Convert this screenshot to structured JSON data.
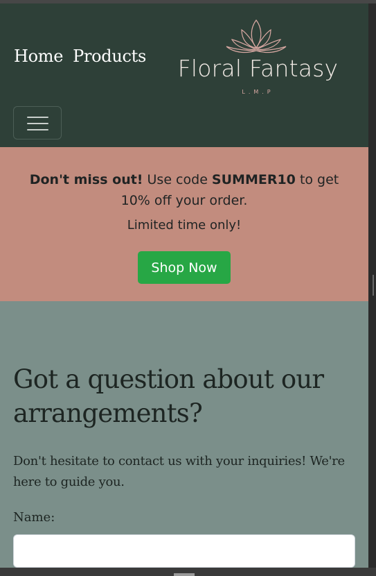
{
  "nav": {
    "home_label": "Home",
    "products_label": "Products",
    "toggle_icon": "hamburger-menu-icon"
  },
  "logo": {
    "name": "Floral Fantasy",
    "subtitle": "L.M.P",
    "icon": "lotus-icon"
  },
  "promo": {
    "lead_bold": "Don't miss out!",
    "text_before_code": " Use code ",
    "code": "SUMMER10",
    "text_after_code": " to get 10% off your order.",
    "limited_text": "Limited time only!",
    "button_label": "Shop Now"
  },
  "contact": {
    "title": "Got a question about our arrangements?",
    "description": "Don't hesitate to contact us with your inquiries! We're here to guide you.",
    "name_label": "Name:",
    "name_value": ""
  },
  "colors": {
    "header_bg": "#2e4038",
    "promo_bg": "#c28c7e",
    "section_bg": "#7b8f8a",
    "button_green": "#27a745",
    "text_dark": "#1d2522"
  }
}
